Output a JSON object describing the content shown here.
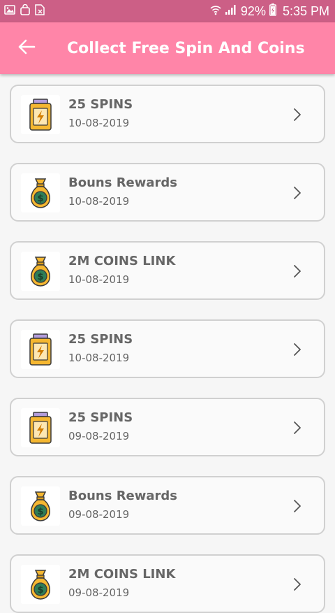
{
  "status_bar": {
    "battery": "92%",
    "time": "5:35 PM",
    "icons": [
      "image-icon",
      "shopping-bag-icon",
      "sim-icon",
      "wifi-icon",
      "signal-icon",
      "battery-charging-icon"
    ]
  },
  "toolbar": {
    "title": "Collect Free Spin And Coins",
    "back_icon": "arrow-left-icon",
    "colors": {
      "toolbar": "#ff85a8",
      "status_bar": "#cc5f86"
    }
  },
  "items": [
    {
      "title": "25 SPINS",
      "date": "10-08-2019",
      "icon": "spin-jar-icon"
    },
    {
      "title": "Bouns Rewards",
      "date": "10-08-2019",
      "icon": "money-bag-icon"
    },
    {
      "title": "2M COINS LINK",
      "date": "10-08-2019",
      "icon": "money-bag-icon"
    },
    {
      "title": "25 SPINS",
      "date": "10-08-2019",
      "icon": "spin-jar-icon"
    },
    {
      "title": "25 SPINS",
      "date": "09-08-2019",
      "icon": "spin-jar-icon"
    },
    {
      "title": "Bouns Rewards",
      "date": "09-08-2019",
      "icon": "money-bag-icon"
    },
    {
      "title": "2M COINS LINK",
      "date": "09-08-2019",
      "icon": "money-bag-icon"
    }
  ]
}
